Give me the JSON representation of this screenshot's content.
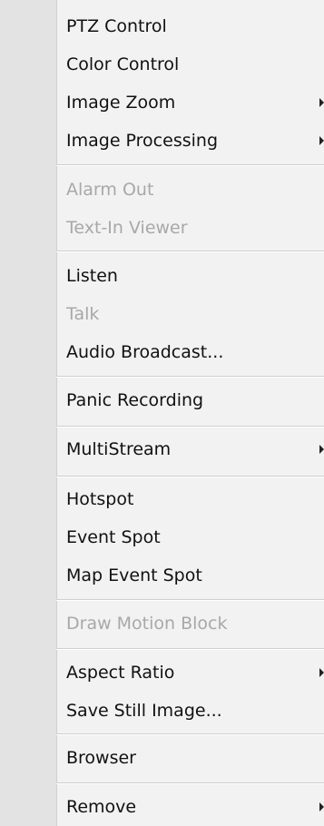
{
  "menu": {
    "ptz_control": "PTZ Control",
    "color_control": "Color Control",
    "image_zoom": "Image Zoom",
    "image_processing": "Image Processing",
    "alarm_out": "Alarm Out",
    "text_in_viewer": "Text-In Viewer",
    "listen": "Listen",
    "talk": "Talk",
    "audio_broadcast": "Audio Broadcast...",
    "panic_recording": "Panic Recording",
    "multistream": "MultiStream",
    "hotspot": "Hotspot",
    "event_spot": "Event Spot",
    "map_event_spot": "Map Event Spot",
    "draw_motion_block": "Draw Motion Block",
    "aspect_ratio": "Aspect Ratio",
    "save_still_image": "Save Still Image...",
    "browser": "Browser",
    "remove": "Remove"
  },
  "icons": {
    "submenu": "submenu-arrow-icon"
  },
  "colors": {
    "enabled_text": "#111111",
    "disabled_text": "#a8a8a8",
    "menu_background": "#f2f2f2",
    "gutter_background": "#e3e3e3"
  }
}
